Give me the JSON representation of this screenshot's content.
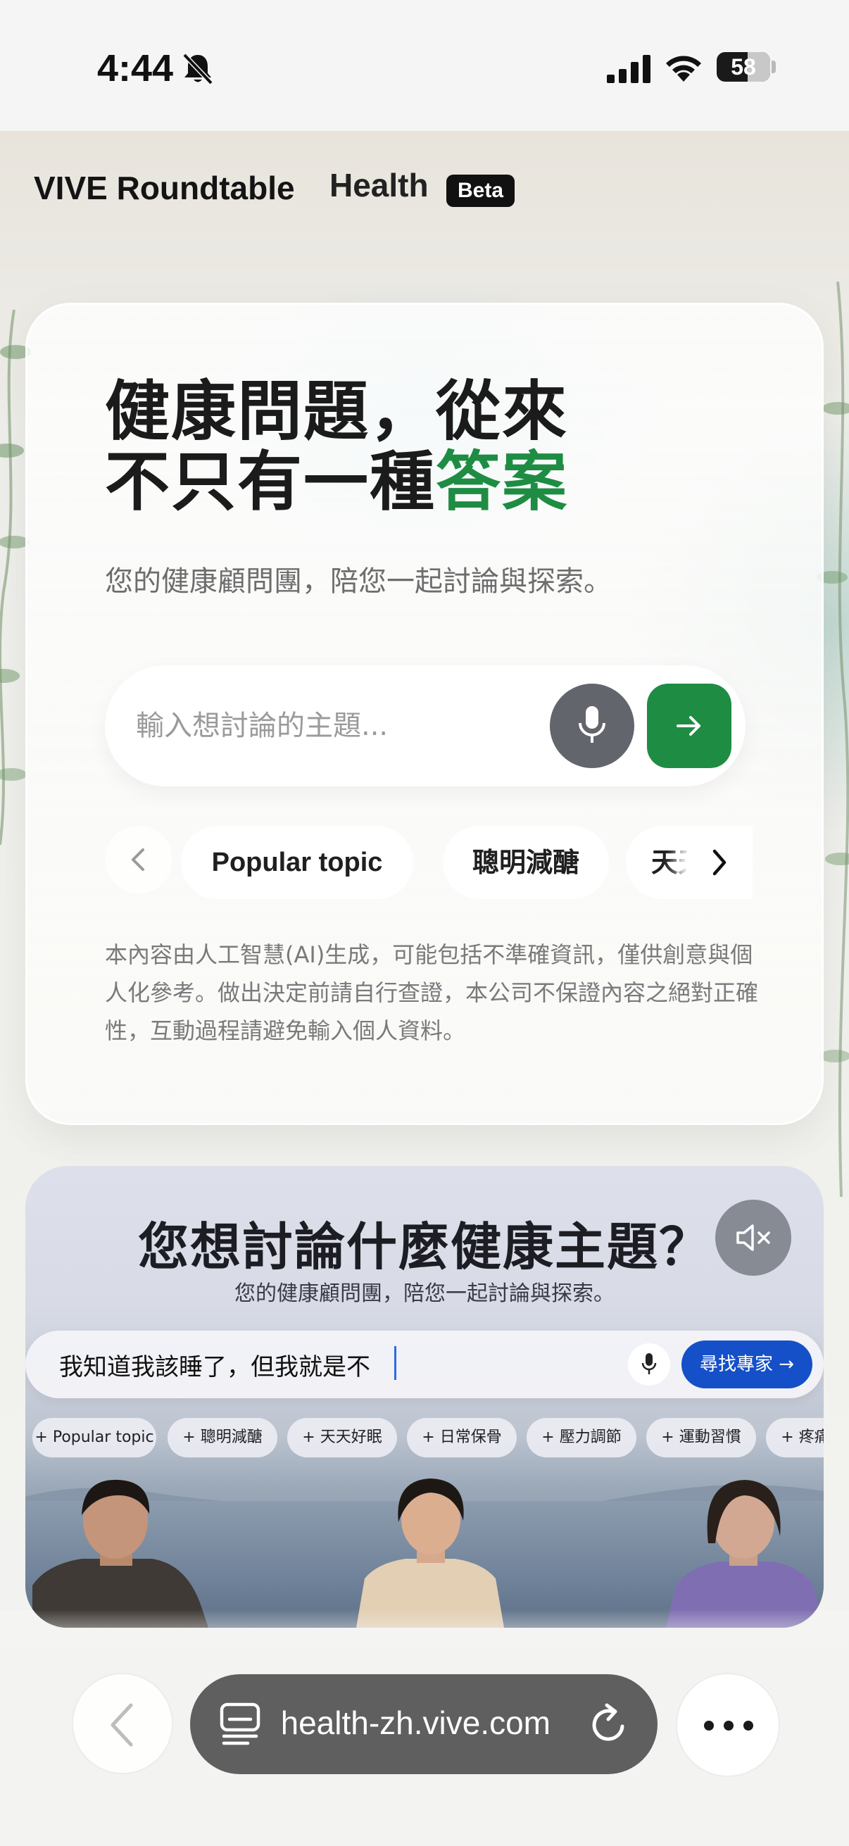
{
  "status_bar": {
    "time": "4:44",
    "battery": "58",
    "battery_level": 0.58
  },
  "header": {
    "brand": "VIVE Roundtable",
    "product": "Health",
    "badge": "Beta"
  },
  "hero": {
    "title_line1": "健康問題，從來",
    "title_line2_prefix": "不只有一種",
    "title_line2_accent": "答案",
    "subtitle": "您的健康顧問團，陪您一起討論與探索。",
    "search_placeholder": "輸入想討論的主題...",
    "topics": [
      "Popular topic",
      "聰明減醣",
      "天天"
    ],
    "disclaimer": "本內容由人工智慧(AI)生成，可能包括不準確資訊，僅供創意與個人化參考。做出決定前請自行查證，本公司不保證內容之絕對正確性，互動過程請避免輸入個人資料。"
  },
  "video_preview": {
    "title": "您想討論什麼健康主題？",
    "subtitle": "您的健康顧問團，陪您一起討論與探索。",
    "search_text": "我知道我該睡了，但我就是不",
    "find_button": "尋找專家 →",
    "chips": [
      "+ Popular topic",
      "+ 聰明減醣",
      "+ 天天好眠",
      "+ 日常保骨",
      "+ 壓力調節",
      "+ 運動習慣",
      "+ 疼痛管理"
    ]
  },
  "browser": {
    "url": "health-zh.vive.com"
  },
  "colors": {
    "accent_green": "#1f8c44",
    "find_button_blue": "#1650c8",
    "url_bar": "#5f5f5f"
  }
}
